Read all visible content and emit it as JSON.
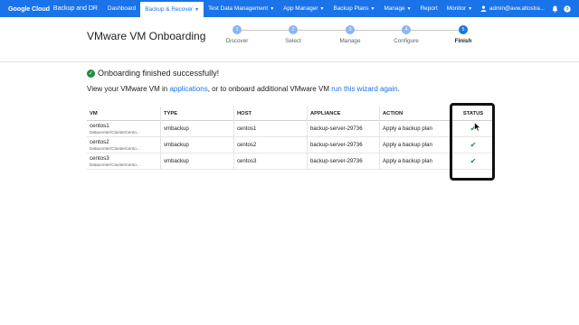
{
  "nav": {
    "brand": "Google Cloud",
    "product": "Backup and DR",
    "items": [
      {
        "label": "Dashboard",
        "caret": false,
        "active": false
      },
      {
        "label": "Backup & Recover",
        "caret": true,
        "active": true
      },
      {
        "label": "Test Data Management",
        "caret": true,
        "active": false
      },
      {
        "label": "App Manager",
        "caret": true,
        "active": false
      },
      {
        "label": "Backup Plans",
        "caret": true,
        "active": false
      },
      {
        "label": "Manage",
        "caret": true,
        "active": false
      },
      {
        "label": "Report",
        "caret": false,
        "active": false
      },
      {
        "label": "Monitor",
        "caret": true,
        "active": false
      }
    ],
    "account": "admin@avw.altostra..."
  },
  "page": {
    "title": "VMware VM Onboarding"
  },
  "steps": [
    {
      "num": "1",
      "label": "Discover"
    },
    {
      "num": "2",
      "label": "Select"
    },
    {
      "num": "3",
      "label": "Manage"
    },
    {
      "num": "4",
      "label": "Configure"
    },
    {
      "num": "5",
      "label": "Finish",
      "current": true
    }
  ],
  "success": {
    "message": "Onboarding finished successfully!",
    "desc_prefix": "View your VMware VM in ",
    "link_applications": "applications",
    "desc_middle": ", or to onboard additional VMware VM ",
    "link_wizard": "run this wizard again",
    "desc_suffix": "."
  },
  "table": {
    "headers": {
      "vm": "VM",
      "type": "TYPE",
      "host": "HOST",
      "appliance": "APPLIANCE",
      "action": "ACTION",
      "status": "STATUS"
    },
    "rows": [
      {
        "vm": "centos1",
        "path": "Datacenter/Cluster/cento...",
        "type": "vmbackup",
        "host": "centos1",
        "appliance": "backup-server-29736",
        "action": "Apply a backup plan",
        "status": "✔"
      },
      {
        "vm": "centos2",
        "path": "Datacenter/Cluster/cento...",
        "type": "vmbackup",
        "host": "centos2",
        "appliance": "backup-server-29736",
        "action": "Apply a backup plan",
        "status": "✔"
      },
      {
        "vm": "centos3",
        "path": "Datacenter/Cluster/cento...",
        "type": "vmbackup",
        "host": "centos3",
        "appliance": "backup-server-29736",
        "action": "Apply a backup plan",
        "status": "✔"
      }
    ]
  },
  "colors": {
    "primary": "#1a73e8",
    "success": "#1e8e3e"
  },
  "icons": [
    "bell-icon",
    "help-icon",
    "user-icon",
    "success-check-icon",
    "status-check-icon"
  ]
}
